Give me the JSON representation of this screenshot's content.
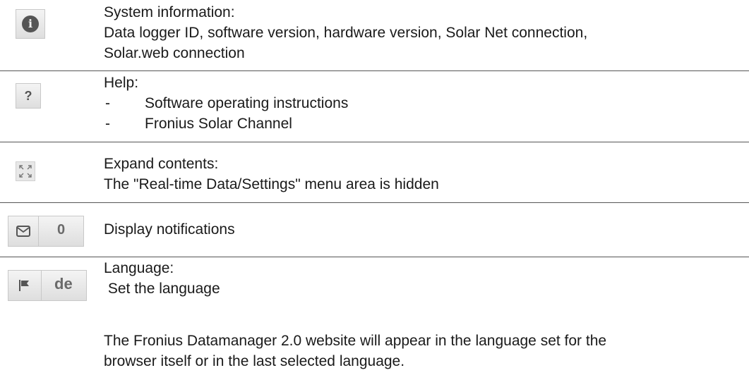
{
  "rows": [
    {
      "icon": "info-icon",
      "lines": [
        "System information:",
        "Data logger ID, software version, hardware version, Solar Net connection,",
        "Solar.web connection"
      ]
    },
    {
      "icon": "help-icon",
      "glyph": "?",
      "title": "Help:",
      "bullet_dash": "-",
      "bullets": [
        "Software operating instructions",
        "Fronius Solar Channel"
      ]
    },
    {
      "icon": "expand-icon",
      "lines": [
        "Expand contents:",
        "The \"Real-time Data/Settings\" menu area is hidden"
      ]
    },
    {
      "icon": "envelope-icon",
      "count": "0",
      "lines": [
        "Display notifications"
      ]
    },
    {
      "icon": "flag-icon",
      "code": "de",
      "lines": [
        "Language:",
        " Set the language"
      ]
    }
  ],
  "footer": {
    "lines": [
      "The Fronius Datamanager 2.0 website will appear in the language set for the",
      "browser itself or in the last selected language."
    ]
  }
}
